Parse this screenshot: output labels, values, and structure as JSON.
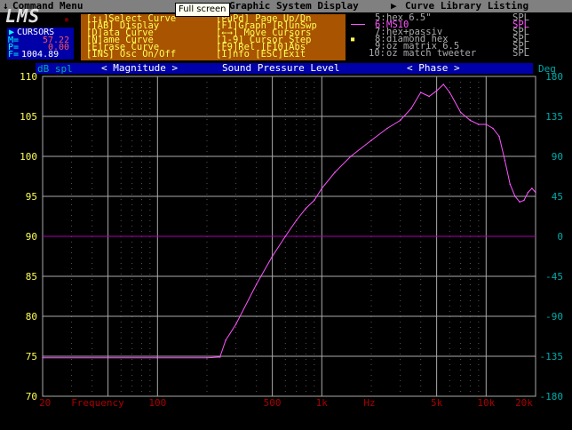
{
  "menubar": {
    "command": "Command Menu",
    "tooltip": "Full screen",
    "graphic": "Graphic System Display",
    "library": "Curve Library Listing"
  },
  "logo": {
    "text": "LMS",
    "mark": "®"
  },
  "cursors": {
    "title": "CURSORS",
    "m_label": "M=",
    "m_value": "57.22",
    "p_label": "P=",
    "p_value": "0.00",
    "f_label": "F=",
    "f_value": "1004.89"
  },
  "command_menu": [
    [
      "[↑↓]Select Curve",
      "[PuPd] Page Up/Dn"
    ],
    [
      "[TAB] Display",
      "[F1]Graph [R]unSwp"
    ],
    [
      "[D]ata Curve",
      "[←→] Move Cursors"
    ],
    [
      "[N]ame Curve",
      "[1-9] Cursor Step"
    ],
    [
      "[E]rase Curve",
      "[F9]Rel [F10]Abs"
    ],
    [
      "[INS] Osc On/Off",
      "[I]nfo [ESC]Exit"
    ]
  ],
  "curve_library": [
    {
      "num": "5",
      "name": "hex 6.5\"",
      "unit": "SPL",
      "color": "#aaaaaa",
      "active": false
    },
    {
      "num": "6",
      "name": "MS10",
      "unit": "SPL",
      "color": "#ff55ff",
      "active": true
    },
    {
      "num": "7",
      "name": "hex+passiv",
      "unit": "SPL",
      "color": "#aaaaaa",
      "active": false
    },
    {
      "num": "8",
      "name": "diamond hex",
      "unit": "SPL",
      "color": "#aaaaaa",
      "active": false
    },
    {
      "num": "9",
      "name": "oz matrix 6.5",
      "unit": "SPL",
      "color": "#aaaaaa",
      "active": false
    },
    {
      "num": "10",
      "name": "oz match tweeter",
      "unit": "SPL",
      "color": "#aaaaaa",
      "active": false
    }
  ],
  "graph_header": {
    "left_unit": "dB spl",
    "magnitude": "< Magnitude >",
    "title": "Sound Pressure Level",
    "phase": "< Phase >",
    "right_unit": "Deg"
  },
  "colors": {
    "curve": "#ff55ff",
    "grid": "#555555",
    "left_axis": "#ffff55",
    "right_axis": "#00aaaa",
    "x_axis": "#aa0000",
    "panel_blue": "#0000a8",
    "panel_orange": "#a85400"
  },
  "x_axis_label": "Frequency",
  "chart_data": {
    "type": "line",
    "title": "Sound Pressure Level",
    "xlabel": "Frequency",
    "ylabel": "dB spl",
    "y2label": "Deg",
    "x_scale": "log",
    "xlim": [
      20,
      20000
    ],
    "ylim": [
      70,
      110
    ],
    "y2lim": [
      -180,
      180
    ],
    "x_ticks": [
      {
        "v": 20,
        "label": "20"
      },
      {
        "v": 100,
        "label": "100"
      },
      {
        "v": 500,
        "label": "500"
      },
      {
        "v": 1000,
        "label": "1k"
      },
      {
        "v": 5000,
        "label": "5k"
      },
      {
        "v": 10000,
        "label": "10k"
      },
      {
        "v": 20000,
        "label": "20k"
      }
    ],
    "x_hz_label": "Hz",
    "y_ticks": [
      110,
      105,
      100,
      95,
      90,
      85,
      80,
      75,
      70
    ],
    "y2_ticks": [
      180,
      135,
      90,
      45,
      0,
      -45,
      -90,
      -135,
      -180
    ],
    "series": [
      {
        "name": "MS10",
        "x": [
          20,
          100,
          200,
          240,
          260,
          300,
          400,
          500,
          600,
          700,
          800,
          900,
          1000,
          1200,
          1500,
          2000,
          2500,
          3000,
          3500,
          4000,
          4500,
          5000,
          5500,
          6000,
          7000,
          8000,
          9000,
          10000,
          11000,
          12000,
          13000,
          14000,
          15000,
          16000,
          17000,
          18000,
          19000,
          20000
        ],
        "y": [
          74.8,
          74.8,
          74.8,
          74.9,
          77,
          79,
          84,
          87.5,
          90,
          92,
          93.5,
          94.5,
          96,
          98,
          100,
          102,
          103.5,
          104.5,
          106,
          108,
          107.5,
          108.2,
          109,
          108,
          105.5,
          104.5,
          104,
          104,
          103.5,
          102.5,
          99.5,
          96.5,
          95,
          94.3,
          94.5,
          95.5,
          96,
          95.5
        ]
      }
    ],
    "grid": true,
    "legend": "none"
  }
}
